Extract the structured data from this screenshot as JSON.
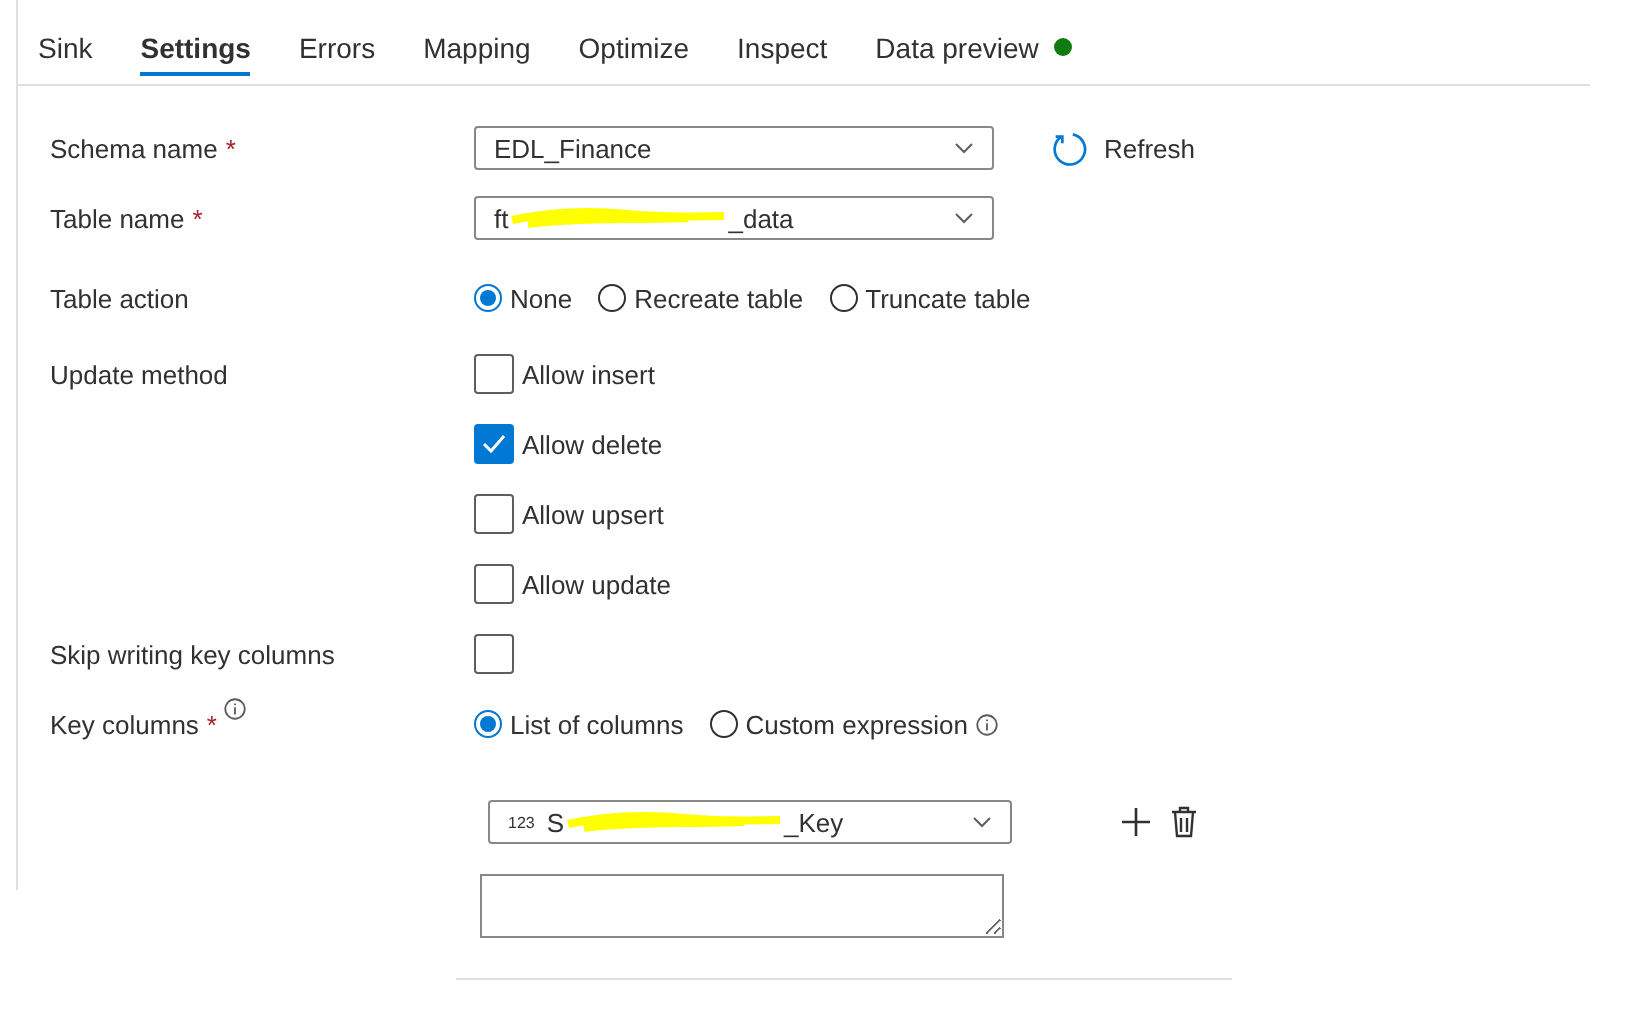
{
  "tabs": [
    {
      "label": "Sink",
      "selected": false
    },
    {
      "label": "Settings",
      "selected": true
    },
    {
      "label": "Errors",
      "selected": false
    },
    {
      "label": "Mapping",
      "selected": false
    },
    {
      "label": "Optimize",
      "selected": false
    },
    {
      "label": "Inspect",
      "selected": false
    },
    {
      "label": "Data preview",
      "selected": false,
      "color": "#107c10"
    }
  ],
  "schema": {
    "label": "Schema name",
    "required_mark": "*",
    "value": "EDL_Finance",
    "refresh": "Refresh"
  },
  "table": {
    "label": "Table name",
    "required_mark": "*",
    "value_start": "ft",
    "value_end": "_data",
    "redacted": true
  },
  "table_action": {
    "label": "Table action",
    "options": [
      {
        "label": "None",
        "selected": true
      },
      {
        "label": "Recreate table",
        "selected": false
      },
      {
        "label": "Truncate table",
        "selected": false
      }
    ]
  },
  "update_method": {
    "label": "Update method",
    "options": [
      {
        "label": "Allow insert",
        "checked": false
      },
      {
        "label": "Allow delete",
        "checked": true
      },
      {
        "label": "Allow upsert",
        "checked": false
      },
      {
        "label": "Allow update",
        "checked": false
      }
    ]
  },
  "skip_key_columns": {
    "label": "Skip writing key columns",
    "checked": false
  },
  "key_columns": {
    "label": "Key columns",
    "required_mark": "*",
    "info": true,
    "options": [
      {
        "label": "List of columns",
        "selected": true
      },
      {
        "label": "Custom expression",
        "selected": false,
        "info": true
      }
    ],
    "column": {
      "type_label": "123",
      "value_start": "S",
      "value_end": "_Key",
      "redacted": true
    }
  }
}
